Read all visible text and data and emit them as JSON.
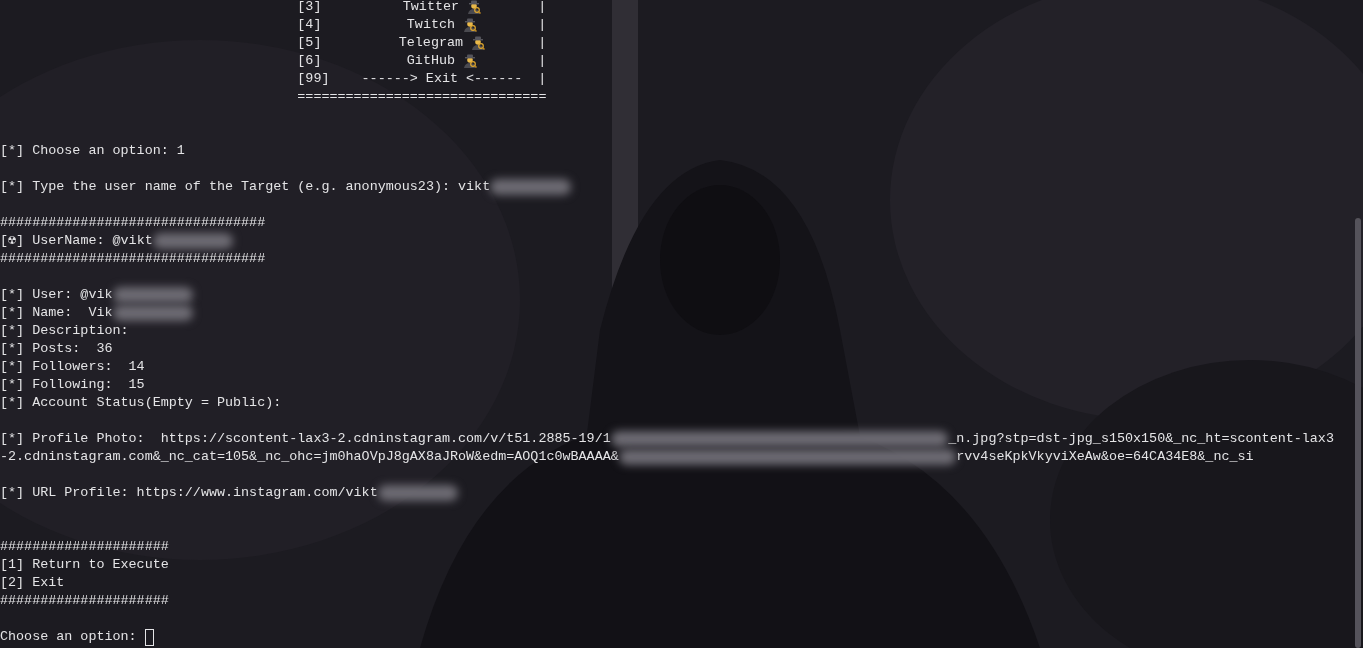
{
  "menu": {
    "items": [
      {
        "number": "[3]",
        "label": "Twitter",
        "icon": true,
        "edge": "|"
      },
      {
        "number": "[4]",
        "label": "Twitch",
        "icon": true,
        "edge": "|"
      },
      {
        "number": "[5]",
        "label": "Telegram",
        "icon": true,
        "edge": "|"
      },
      {
        "number": "[6]",
        "label": "GitHub",
        "icon": true,
        "edge": "|"
      },
      {
        "number": "[99]",
        "label": "------> Exit <------",
        "icon": false,
        "edge": "|"
      }
    ],
    "rule": "==============================="
  },
  "lines": [
    {
      "kind": "blank"
    },
    {
      "kind": "blank"
    },
    {
      "kind": "text",
      "parts": [
        "[*] Choose an option: 1"
      ]
    },
    {
      "kind": "blank"
    },
    {
      "kind": "text",
      "parts": [
        "[*] Type the user name of the Target (e.g. anonymous23): vikt"
      ],
      "redacted": true
    },
    {
      "kind": "blank"
    },
    {
      "kind": "rule",
      "parts": [
        "#################################"
      ]
    },
    {
      "kind": "text",
      "parts": [
        "[☢] UserName: @vikt"
      ],
      "redacted": true
    },
    {
      "kind": "rule",
      "parts": [
        "#################################"
      ]
    },
    {
      "kind": "blank"
    },
    {
      "kind": "text",
      "parts": [
        "[*] User: @vik"
      ],
      "redacted": true
    },
    {
      "kind": "text",
      "parts": [
        "[*] Name:  Vik"
      ],
      "redacted": true
    },
    {
      "kind": "text",
      "parts": [
        "[*] Description:"
      ]
    },
    {
      "kind": "text",
      "parts": [
        "[*] Posts:  36"
      ]
    },
    {
      "kind": "text",
      "parts": [
        "[*] Followers:  14"
      ]
    },
    {
      "kind": "text",
      "parts": [
        "[*] Following:  15"
      ]
    },
    {
      "kind": "text",
      "parts": [
        "[*] Account Status(Empty = Public):"
      ]
    },
    {
      "kind": "blank"
    },
    {
      "kind": "text",
      "parts": [
        "[*] Profile Photo:  https://scontent-lax3-2.cdninstagram.com/v/t51.2885-19/1",
        "_n.jpg?stp=dst-jpg_s150x150&_nc_ht=scontent-lax3"
      ],
      "redacted": true
    },
    {
      "kind": "text",
      "parts": [
        "-2.cdninstagram.com&_nc_cat=105&_nc_ohc=jm0haOVpJ8gAX8aJRoW&edm=AOQ1c0wBAAAA&",
        "rvv4seKpkVkyviXeAw&oe=64CA34E8&_nc_si"
      ],
      "redacted": true
    },
    {
      "kind": "blank"
    },
    {
      "kind": "text",
      "parts": [
        "[*] URL Profile: https://www.instagram.com/vikt"
      ],
      "redacted": true
    },
    {
      "kind": "blank"
    },
    {
      "kind": "blank"
    },
    {
      "kind": "rule",
      "parts": [
        "#####################"
      ]
    },
    {
      "kind": "text",
      "parts": [
        "[1] Return to Execute"
      ]
    },
    {
      "kind": "text",
      "parts": [
        "[2] Exit"
      ]
    },
    {
      "kind": "rule",
      "parts": [
        "#####################"
      ]
    },
    {
      "kind": "blank"
    },
    {
      "kind": "prompt",
      "parts": [
        "Choose an option: "
      ]
    }
  ]
}
